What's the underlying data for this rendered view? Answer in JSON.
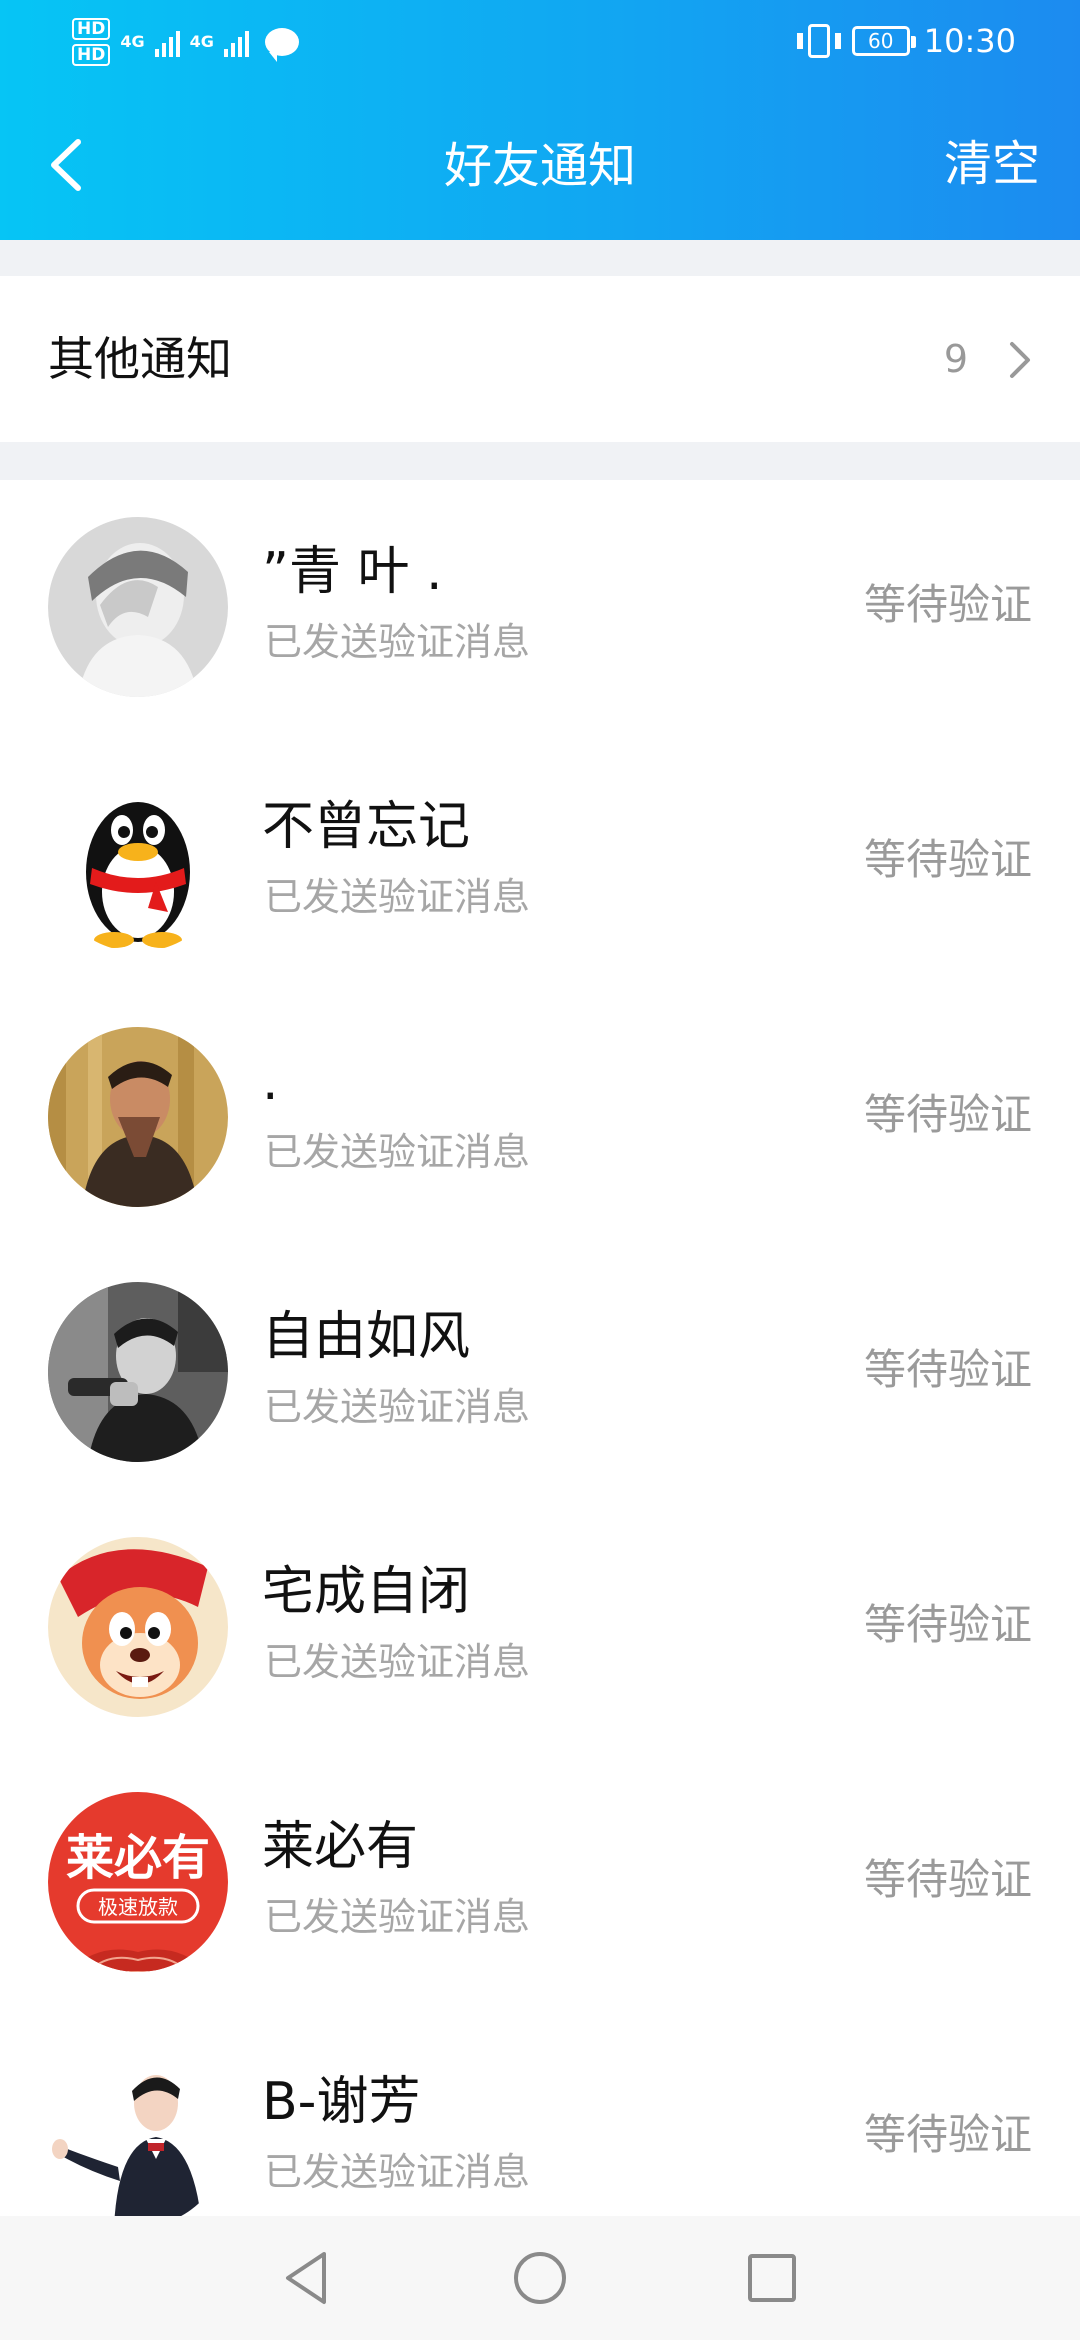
{
  "status_bar": {
    "hd1": "HD",
    "hd2": "HD",
    "network1": "4G",
    "network2": "4G",
    "battery": "60",
    "time": "10:30"
  },
  "header": {
    "title": "好友通知",
    "clear_label": "清空"
  },
  "other_notices": {
    "label": "其他通知",
    "count": "9"
  },
  "friends": [
    {
      "name": "”青 叶 .",
      "subtitle": "已发送验证消息",
      "status": "等待验证",
      "avatar": "gray-portrait"
    },
    {
      "name": "不曾忘记",
      "subtitle": "已发送验证消息",
      "status": "等待验证",
      "avatar": "penguin"
    },
    {
      "name": ".",
      "subtitle": "已发送验证消息",
      "status": "等待验证",
      "avatar": "tattoo-portrait"
    },
    {
      "name": "自由如风",
      "subtitle": "已发送验证消息",
      "status": "等待验证",
      "avatar": "bw-portrait"
    },
    {
      "name": "宅成自闭",
      "subtitle": "已发送验证消息",
      "status": "等待验证",
      "avatar": "cartoon-mouse"
    },
    {
      "name": "莱必有",
      "subtitle": "已发送验证消息",
      "status": "等待验证",
      "avatar": "brand-logo",
      "avatar_text": "莱必有",
      "avatar_subtext": "极速放款"
    },
    {
      "name": "B-谢芳",
      "subtitle": "已发送验证消息",
      "status": "等待验证",
      "avatar": "uniform-portrait"
    }
  ],
  "colors": {
    "header_start": "#06c5f5",
    "header_end": "#1c8bf0",
    "secondary_text": "#a6a6a6",
    "divider_bg": "#f0f2f5"
  }
}
